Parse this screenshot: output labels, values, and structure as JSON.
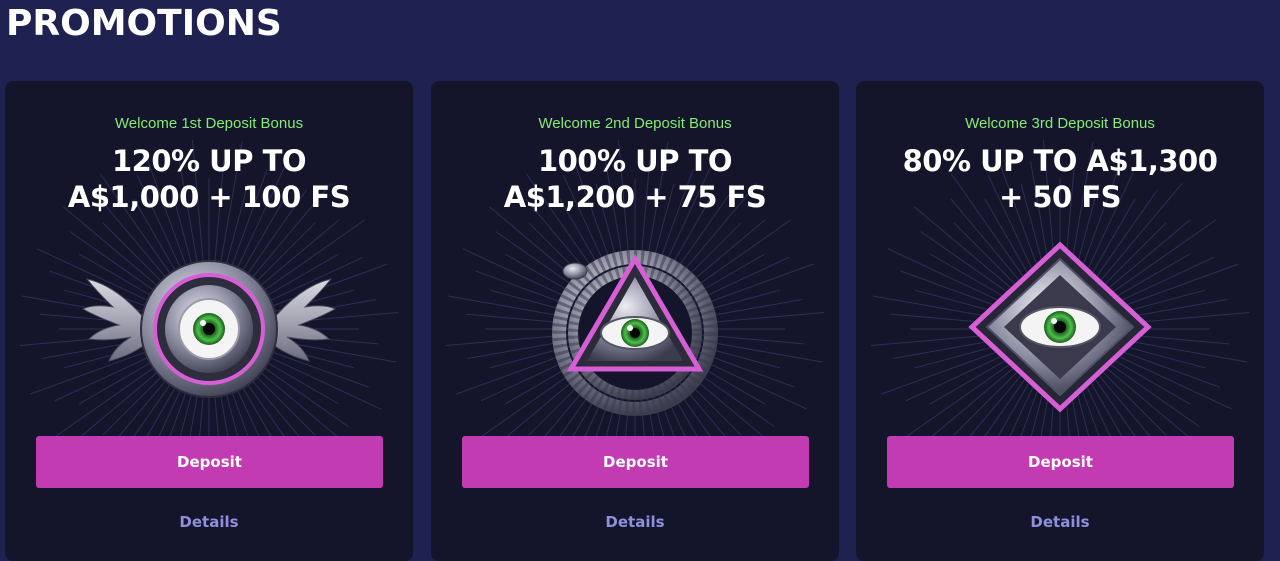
{
  "page": {
    "title": "PROMOTIONS"
  },
  "colors": {
    "background": "#1f2150",
    "card": "#14152b",
    "subtitle": "#86ea74",
    "button": "#c33bb3",
    "link": "#8f8fde",
    "emblem_accent": "#d75fd6",
    "eye_iris": "#3fa23a"
  },
  "promotions": [
    {
      "subtitle": "Welcome 1st Deposit Bonus",
      "headline_line1": "120% UP TO",
      "headline_line2": "A$1,000 + 100 FS",
      "emblem_icon": "winged-eye-emblem-icon",
      "button_label": "Deposit",
      "details_label": "Details"
    },
    {
      "subtitle": "Welcome 2nd Deposit Bonus",
      "headline_line1": "100% UP TO",
      "headline_line2": "A$1,200 + 75 FS",
      "emblem_icon": "serpent-triangle-eye-emblem-icon",
      "button_label": "Deposit",
      "details_label": "Details"
    },
    {
      "subtitle": "Welcome 3rd Deposit Bonus",
      "headline_line1": "80% UP TO A$1,300",
      "headline_line2": "+ 50 FS",
      "emblem_icon": "diamond-eye-emblem-icon",
      "button_label": "Deposit",
      "details_label": "Details"
    }
  ]
}
